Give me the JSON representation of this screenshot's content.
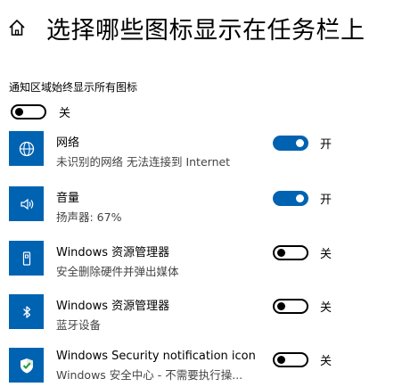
{
  "header": {
    "title": "选择哪些图标显示在任务栏上",
    "home_icon": "home-icon"
  },
  "always_show": {
    "label": "通知区域始终显示所有图标",
    "state": "关",
    "on": false
  },
  "items": [
    {
      "name": "网络",
      "sub": "未识别的网络 无法连接到 Internet",
      "state": "开",
      "on": true,
      "icon": "network-icon"
    },
    {
      "name": "音量",
      "sub": "扬声器: 67%",
      "state": "开",
      "on": true,
      "icon": "speaker-icon"
    },
    {
      "name": "Windows 资源管理器",
      "sub": "安全删除硬件并弹出媒体",
      "state": "关",
      "on": false,
      "icon": "usb-eject-icon"
    },
    {
      "name": "Windows 资源管理器",
      "sub": "蓝牙设备",
      "state": "关",
      "on": false,
      "icon": "bluetooth-icon"
    },
    {
      "name": "Windows Security notification icon",
      "sub": "Windows 安全中心 - 不需要执行操...",
      "state": "关",
      "on": false,
      "icon": "security-shield-icon"
    }
  ],
  "colors": {
    "accent": "#0063b1"
  }
}
